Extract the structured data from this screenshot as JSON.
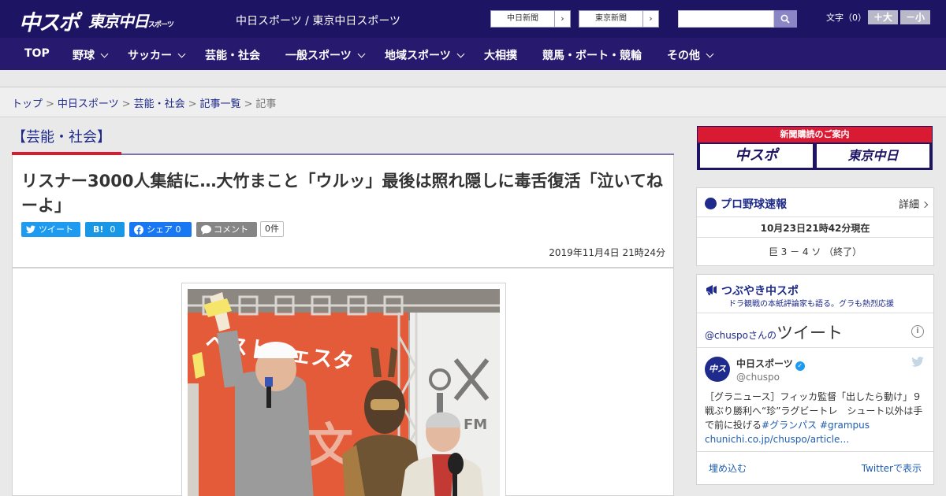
{
  "header": {
    "logo_main": "中スポ",
    "logo_tokyo": "東京中日",
    "logo_tokyo_small": "スポーツ",
    "site_links": "中日スポーツ / 東京中日スポーツ",
    "ext_link_1": "中日新聞",
    "ext_link_2": "東京新聞",
    "search_placeholder": "",
    "fontsize_label": "文字（0）",
    "font_up": "＋大",
    "font_down": "－小"
  },
  "nav": {
    "items": [
      {
        "label": "TOP",
        "has_menu": false
      },
      {
        "label": "野球",
        "has_menu": true
      },
      {
        "label": "サッカー",
        "has_menu": true
      },
      {
        "label": "芸能・社会",
        "has_menu": false
      },
      {
        "label": "一般スポーツ",
        "has_menu": true
      },
      {
        "label": "地域スポーツ",
        "has_menu": true
      },
      {
        "label": "大相撲",
        "has_menu": false
      },
      {
        "label": "競馬・ボート・競輪",
        "has_menu": false
      },
      {
        "label": "その他",
        "has_menu": true
      }
    ]
  },
  "breadcrumb": {
    "items": [
      "トップ",
      "中日スポーツ",
      "芸能・社会",
      "記事一覧",
      "記事"
    ],
    "separator": ">"
  },
  "article": {
    "category": "【芸能・社会】",
    "title": "リスナー3000人集結に…大竹まこと「ウルッ」最後は照れ隠しに毒舌復活「泣いてねーよ」",
    "share": {
      "tweet": "ツイート",
      "hatena": "B!",
      "hatena_count": "0",
      "facebook": "シェア 0",
      "comment": "コメント",
      "comment_count": "0件"
    },
    "date": "2019年11月4日 21時24分",
    "photo_sign_text": "ベストフェスタ"
  },
  "sidebar": {
    "ad": {
      "top": "新聞購読のご案内",
      "logo_1": "中スポ",
      "logo_2": "東京中日"
    },
    "baseball": {
      "title": "プロ野球速報",
      "detail": "詳細",
      "timestamp": "10月23日21時42分現在",
      "score": "巨 3 － 4 ソ （終了）"
    },
    "twitter": {
      "title": "つぶやき中スポ",
      "subtitle": "ドラ観戦の本紙評論家も語る。グラも熱烈応援",
      "handle_prefix": "@chuspo",
      "handle_suffix": "さんの",
      "heading": "ツイート",
      "account_name": "中日スポーツ",
      "account_handle": "@chuspo",
      "tweet_text_1": "［グラニュース］フィッカ監督「出したら動け」９戦ぶり勝利へ“珍”ラグビートレ　シュート以外は手で前に投げる",
      "tweet_tag_1": "#グランパス",
      "tweet_tag_2": "#grampus",
      "tweet_link": "chunichi.co.jp/chuspo/article…",
      "embed": "埋め込む",
      "view_on": "Twitterで表示"
    }
  },
  "colors": {
    "header_bg": "#1e1464",
    "nav_bg": "#27196e",
    "accent_red": "#d81a33",
    "link_blue": "#1e2a8c",
    "twitter_blue": "#1d9bf0"
  }
}
